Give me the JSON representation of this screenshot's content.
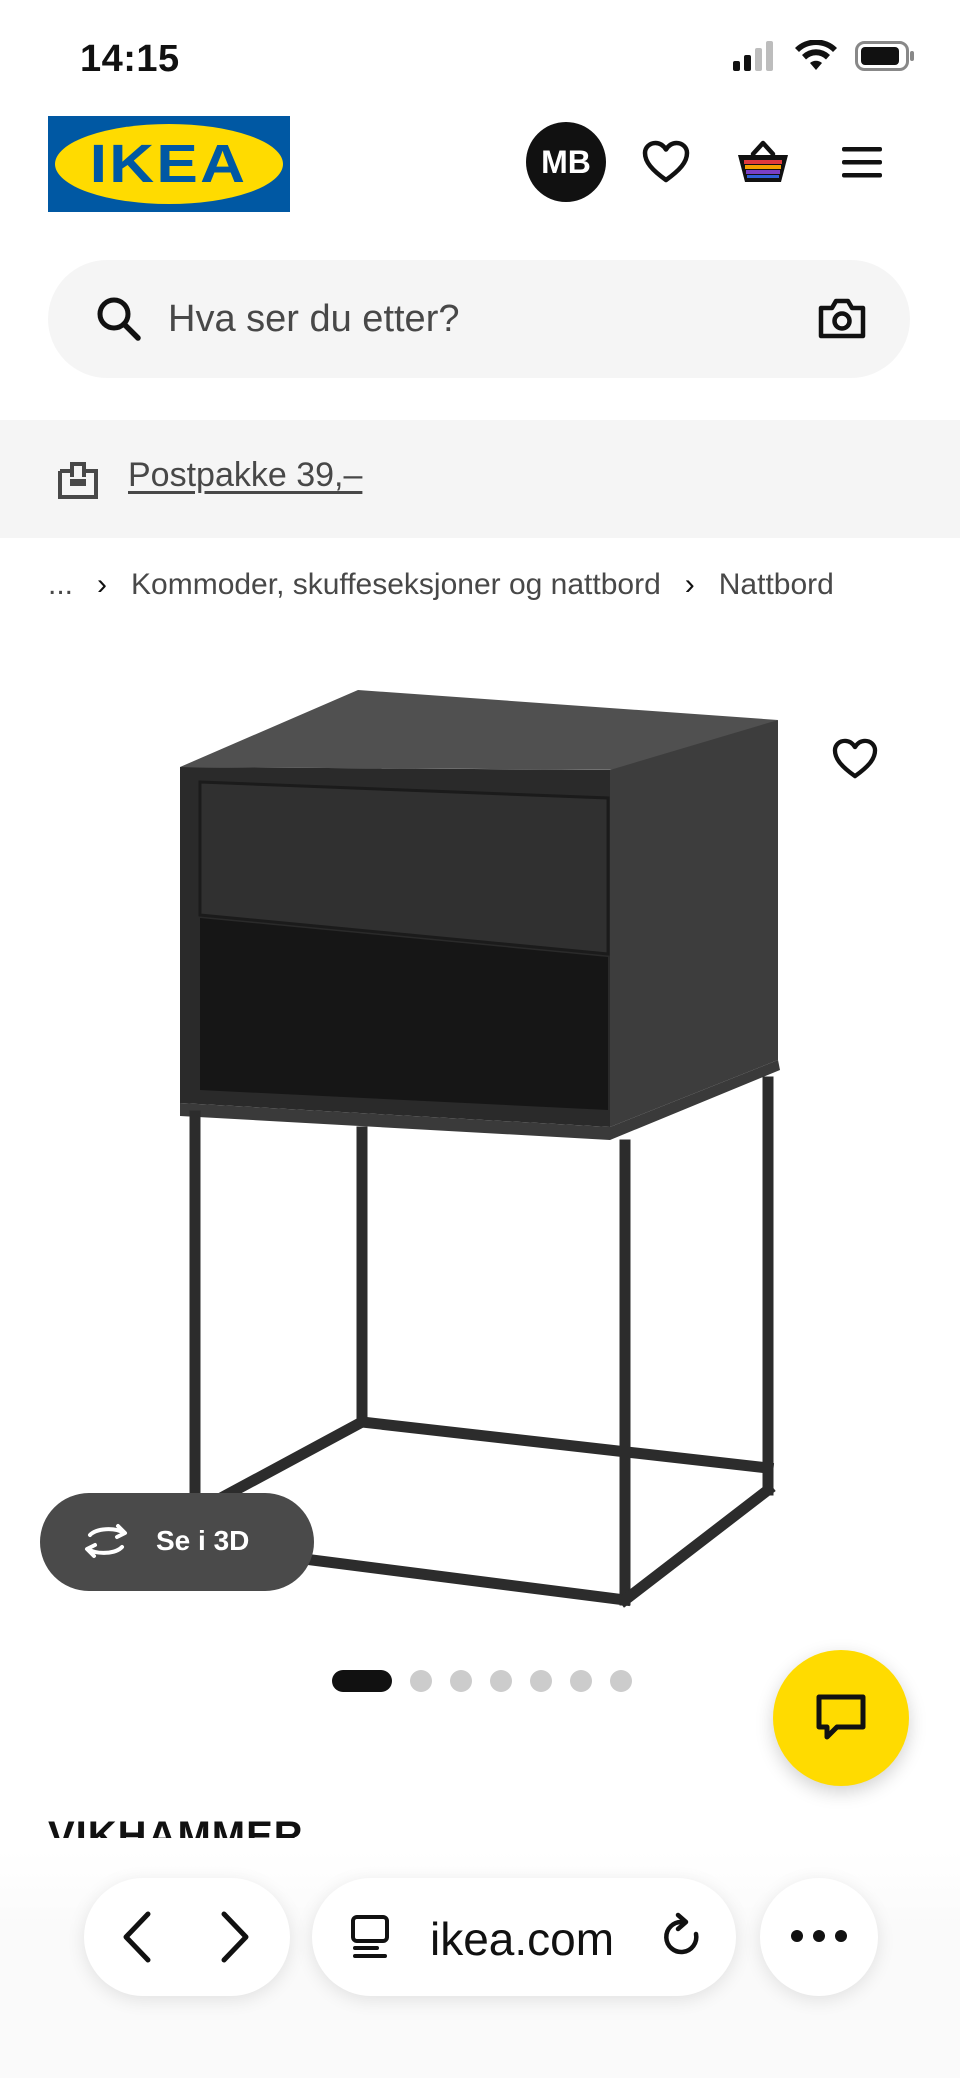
{
  "status": {
    "time": "14:15"
  },
  "header": {
    "logo_text": "IKEA",
    "avatar_initials": "MB",
    "icons": [
      "heart-icon",
      "basket-icon",
      "menu-icon"
    ]
  },
  "search": {
    "placeholder": "Hva ser du etter?"
  },
  "delivery": {
    "text": "Postpakke 39,–"
  },
  "breadcrumb": {
    "items": [
      "...",
      "Kommoder, skuffeseksjoner og nattbord",
      "Nattbord"
    ]
  },
  "product": {
    "view3d_label": "Se i 3D",
    "name": "VIKHAMMER",
    "image_count": 7,
    "active_image": 1
  },
  "browser": {
    "url": "ikea.com"
  },
  "colors": {
    "ikea_blue": "#0058a3",
    "ikea_yellow": "#ffdb00",
    "product_black": "#2b2b2b"
  }
}
